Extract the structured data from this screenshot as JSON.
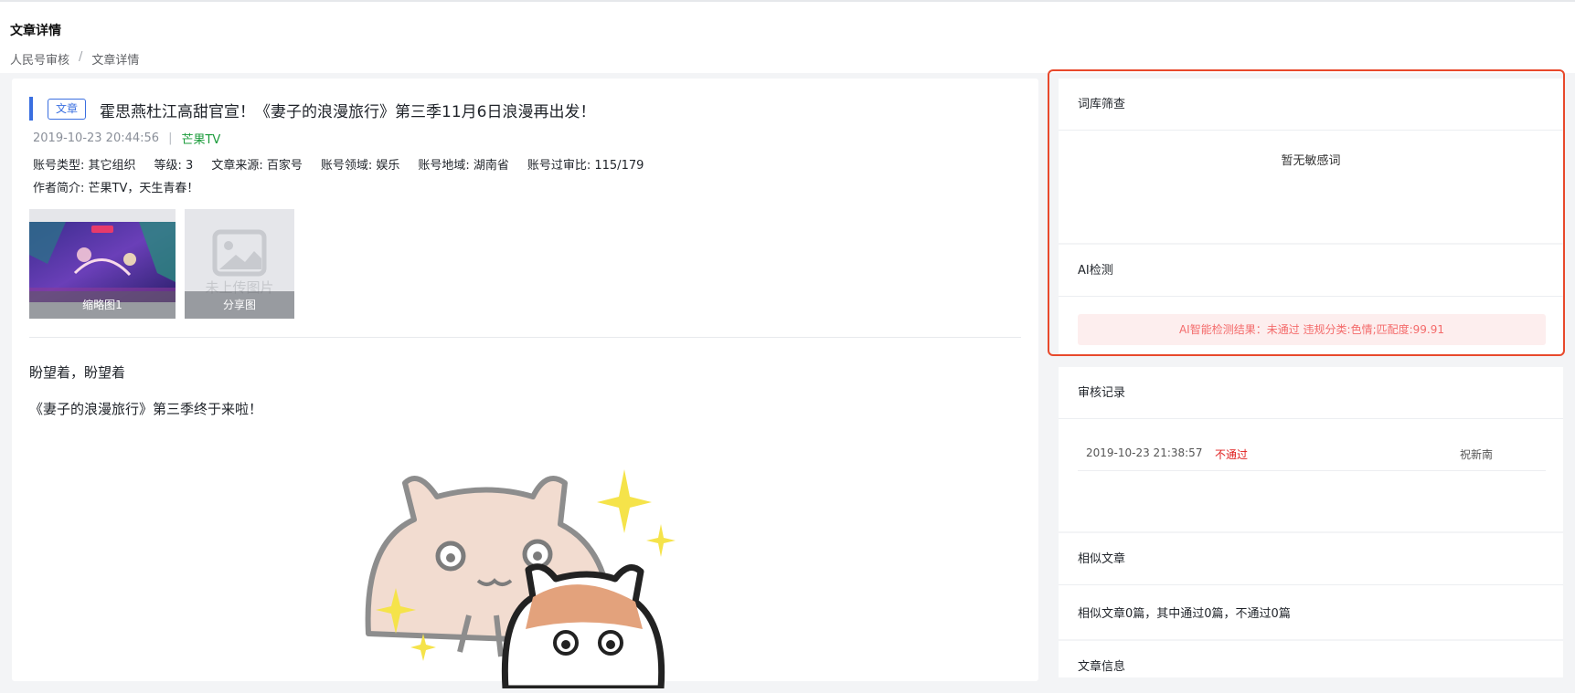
{
  "header": {
    "page_title": "文章详情",
    "breadcrumb": [
      "人民号审核",
      "/",
      "文章详情"
    ]
  },
  "article": {
    "type_tag": "文章",
    "title": "霍思燕杜江高甜官宣！《妻子的浪漫旅行》第三季11月6日浪漫再出发！",
    "publish_time": "2019-10-23 20:44:56",
    "meta_separator": "|",
    "source": "芒果TV",
    "info": [
      "账号类型: 其它组织",
      "等级: 3",
      "文章来源: 百家号",
      "账号领域: 娱乐",
      "账号地域: 湖南省",
      "账号过审比: 115/179"
    ],
    "intro": "作者简介: 芒果TV，天生青春！",
    "thumbs": [
      {
        "caption": "缩略图1",
        "has_image": true
      },
      {
        "caption": "分享图",
        "has_image": false,
        "placeholder": "未上传图片"
      }
    ],
    "paragraphs": [
      "盼望着，盼望着",
      "《妻子的浪漫旅行》第三季终于来啦！"
    ]
  },
  "panels": {
    "lexicon": {
      "title": "词库筛查",
      "empty_text": "暂无敏感词"
    },
    "ai": {
      "title": "AI检测",
      "result": "AI智能检测结果：未通过 违规分类:色情;匹配度:99.91"
    },
    "review": {
      "title": "审核记录",
      "rows": [
        {
          "time": "2019-10-23 21:38:57",
          "status": "不通过",
          "user": "祝新南"
        }
      ]
    },
    "similar": {
      "title": "相似文章",
      "summary": "相似文章0篇，其中通过0篇，不通过0篇"
    },
    "info": {
      "title": "文章信息"
    }
  },
  "colors": {
    "accent": "#3a6fe0",
    "source_green": "#1a9b3a",
    "alert_red": "#f46b6b",
    "status_fail": "#e02020",
    "highlight_border": "#e8492c"
  }
}
